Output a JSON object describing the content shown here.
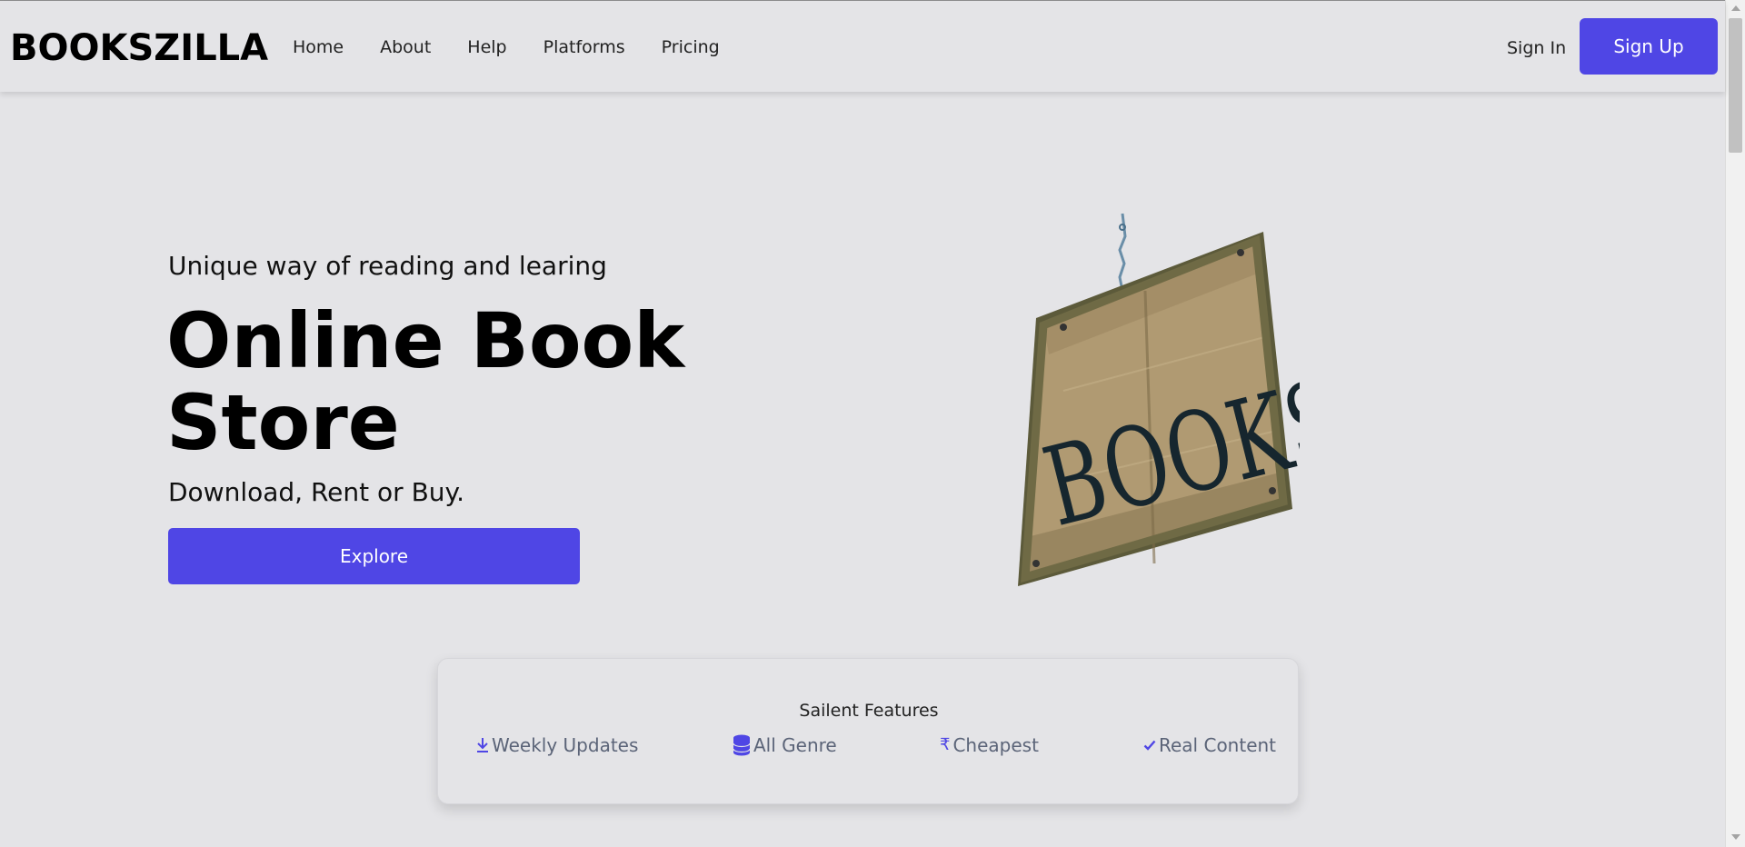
{
  "navbar": {
    "brand": "BOOKSZILLA",
    "links": [
      "Home",
      "About",
      "Help",
      "Platforms",
      "Pricing"
    ],
    "signin_label": "Sign In",
    "signup_label": "Sign Up"
  },
  "hero": {
    "tagline": "Unique way of reading and learing",
    "title": "Online Book Store",
    "subtitle": "Download, Rent or Buy.",
    "explore_label": "Explore",
    "image_alt": "BOOKS"
  },
  "features": {
    "title": "Sailent Features",
    "items": [
      {
        "label": "Weekly Updates",
        "icon": "download-icon"
      },
      {
        "label": "All Genre",
        "icon": "database-icon"
      },
      {
        "label": "Cheapest",
        "icon": "rupee-icon"
      },
      {
        "label": "Real Content",
        "icon": "check-icon"
      }
    ]
  },
  "colors": {
    "accent": "#4f46e5",
    "background": "#e4e4e7",
    "feature_text": "#5b6478"
  }
}
